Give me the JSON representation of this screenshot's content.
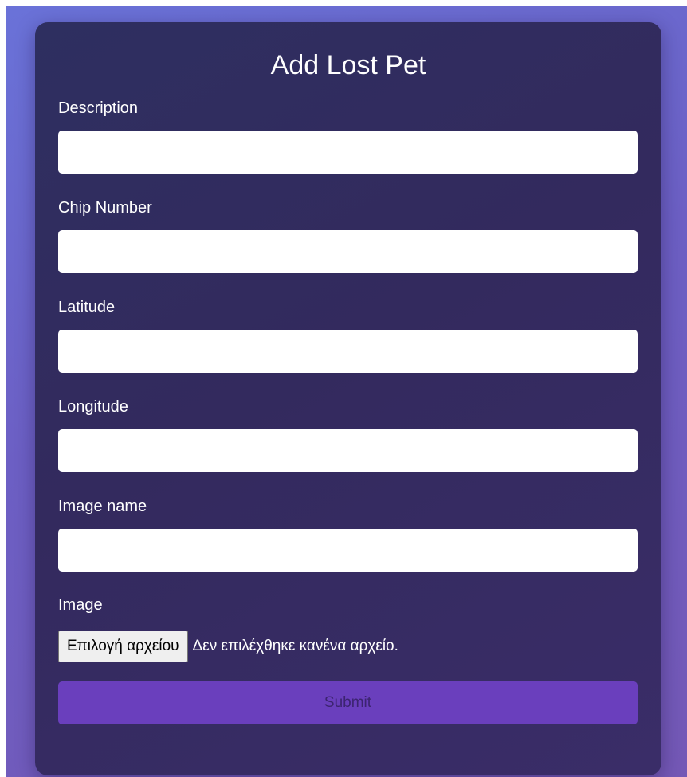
{
  "form": {
    "title": "Add Lost Pet",
    "fields": [
      {
        "label": "Description",
        "value": "",
        "placeholder": ""
      },
      {
        "label": "Chip Number",
        "value": "",
        "placeholder": ""
      },
      {
        "label": "Latitude",
        "value": "",
        "placeholder": ""
      },
      {
        "label": "Longitude",
        "value": "",
        "placeholder": ""
      },
      {
        "label": "Image name",
        "value": "",
        "placeholder": ""
      }
    ],
    "image": {
      "label": "Image",
      "button_label": "Επιλογή αρχείου",
      "status_text": "Δεν επιλέχθηκε κανένα αρχείο."
    },
    "submit_label": "Submit"
  },
  "colors": {
    "background_gradient": [
      "#6a72d8",
      "#7458b6"
    ],
    "card": "#302c60",
    "submit_button": "#6a3fbd",
    "submit_text": "#3c2470"
  }
}
